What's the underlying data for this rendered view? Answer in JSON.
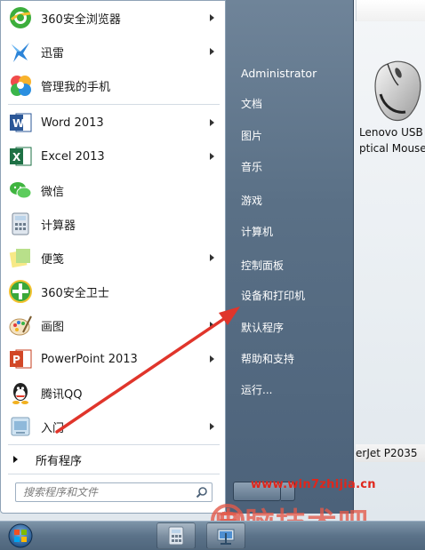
{
  "start_menu": {
    "programs": [
      {
        "label": "360安全浏览器",
        "icon": "360-browser-icon",
        "has_submenu": true
      },
      {
        "label": "迅雷",
        "icon": "xunlei-icon",
        "has_submenu": true
      },
      {
        "label": "管理我的手机",
        "icon": "phone-manager-icon",
        "has_submenu": false
      },
      {
        "label": "Word 2013",
        "icon": "word-icon",
        "has_submenu": true
      },
      {
        "label": "Excel 2013",
        "icon": "excel-icon",
        "has_submenu": true
      },
      {
        "label": "微信",
        "icon": "wechat-icon",
        "has_submenu": false
      },
      {
        "label": "计算器",
        "icon": "calculator-icon",
        "has_submenu": false
      },
      {
        "label": "便笺",
        "icon": "sticky-notes-icon",
        "has_submenu": true
      },
      {
        "label": "360安全卫士",
        "icon": "360-security-icon",
        "has_submenu": false
      },
      {
        "label": "画图",
        "icon": "paint-icon",
        "has_submenu": true
      },
      {
        "label": "PowerPoint 2013",
        "icon": "powerpoint-icon",
        "has_submenu": true
      },
      {
        "label": "腾讯QQ",
        "icon": "qq-icon",
        "has_submenu": false
      },
      {
        "label": "入门",
        "icon": "getting-started-icon",
        "has_submenu": true
      }
    ],
    "all_programs_label": "所有程序",
    "search_placeholder": "搜索程序和文件",
    "right_items": [
      "Administrator",
      "文档",
      "图片",
      "音乐",
      "游戏",
      "计算机",
      "控制面板",
      "设备和打印机",
      "默认程序",
      "帮助和支持",
      "运行..."
    ]
  },
  "desktop": {
    "mouse_label_line1": "Lenovo USB",
    "mouse_label_line2": "ptical Mouse",
    "printer_label": "erJet P2035"
  },
  "watermark": {
    "url": "www.win7zhijia.cn",
    "brand": "电脑技术吧"
  },
  "colors": {
    "arrow": "#e0352b",
    "right_pane": "#5a7086"
  }
}
